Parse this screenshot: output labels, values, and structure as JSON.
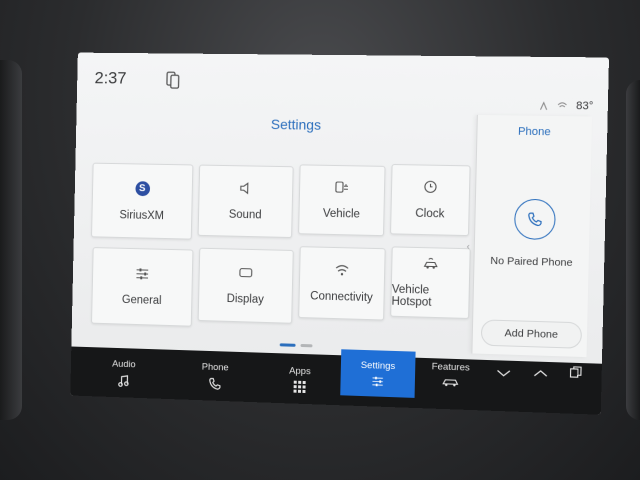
{
  "status": {
    "time": "2:37",
    "temperature": "83°",
    "icons": [
      "phone-projection-icon",
      "signal-icon",
      "wifi-icon"
    ]
  },
  "settings": {
    "title": "Settings",
    "tiles": [
      {
        "label": "SiriusXM",
        "icon": "siriusxm-logo",
        "logo_text": "S"
      },
      {
        "label": "Sound",
        "icon": "speaker-icon"
      },
      {
        "label": "Vehicle",
        "icon": "vehicle-settings-icon"
      },
      {
        "label": "Clock",
        "icon": "clock-icon"
      },
      {
        "label": "General",
        "icon": "sliders-icon"
      },
      {
        "label": "Display",
        "icon": "display-icon"
      },
      {
        "label": "Connectivity",
        "icon": "wifi-icon"
      },
      {
        "label": "Vehicle Hotspot",
        "icon": "car-hotspot-icon"
      }
    ],
    "pagination": {
      "pages": 2,
      "active": 1
    }
  },
  "phone_panel": {
    "title": "Phone",
    "status_text": "No Paired Phone",
    "add_button": "Add Phone"
  },
  "nav": {
    "items": [
      {
        "label": "Audio",
        "icon": "music-note-icon"
      },
      {
        "label": "Phone",
        "icon": "phone-icon"
      },
      {
        "label": "Apps",
        "icon": "apps-grid-icon"
      },
      {
        "label": "Settings",
        "icon": "sliders-icon",
        "active": true
      },
      {
        "label": "Features",
        "icon": "car-features-icon"
      },
      {
        "label": "",
        "icon": "chevron-down-icon"
      },
      {
        "label": "",
        "icon": "chevron-up-icon"
      },
      {
        "label": "",
        "icon": "multi-screen-icon"
      }
    ]
  },
  "colors": {
    "accent": "#2c6fbd",
    "nav_active": "#1f6fd6",
    "nav_background": "#161718",
    "screen_background": "#f2f3f4"
  }
}
